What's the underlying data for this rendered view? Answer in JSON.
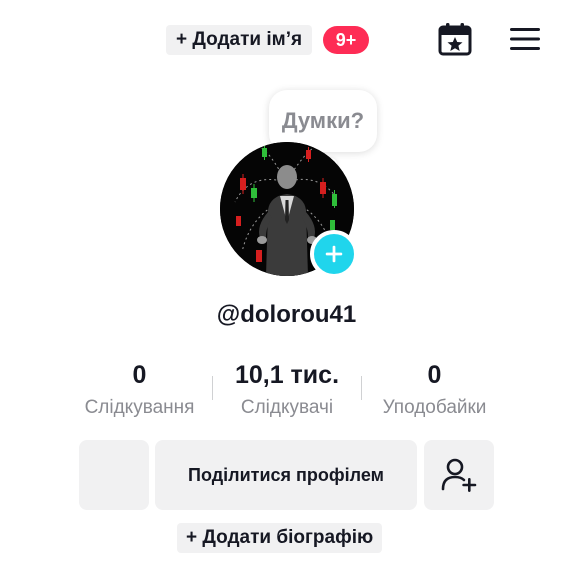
{
  "header": {
    "add_name_label": "+ Додати ім’я",
    "notification_badge": "9+",
    "calendar_icon": "calendar-star-icon",
    "menu_icon": "hamburger-menu-icon"
  },
  "profile": {
    "thought_bubble": "Думки?",
    "username": "@dolorou41",
    "add_avatar_icon": "plus-icon"
  },
  "stats": [
    {
      "value": "0",
      "label": "Слідкування"
    },
    {
      "value": "10,1 тис.",
      "label": "Слідкувачі"
    },
    {
      "value": "0",
      "label": "Уподобайки"
    }
  ],
  "actions": {
    "share_label": "Поділитися профілем",
    "add_friend_icon": "add-user-icon"
  },
  "bio": {
    "add_bio_label": "+ Додати біографію"
  },
  "colors": {
    "accent_red": "#fe2c55",
    "accent_cyan": "#20d5ec",
    "button_bg": "#f1f1f2",
    "secondary_text": "#8a8b91"
  }
}
